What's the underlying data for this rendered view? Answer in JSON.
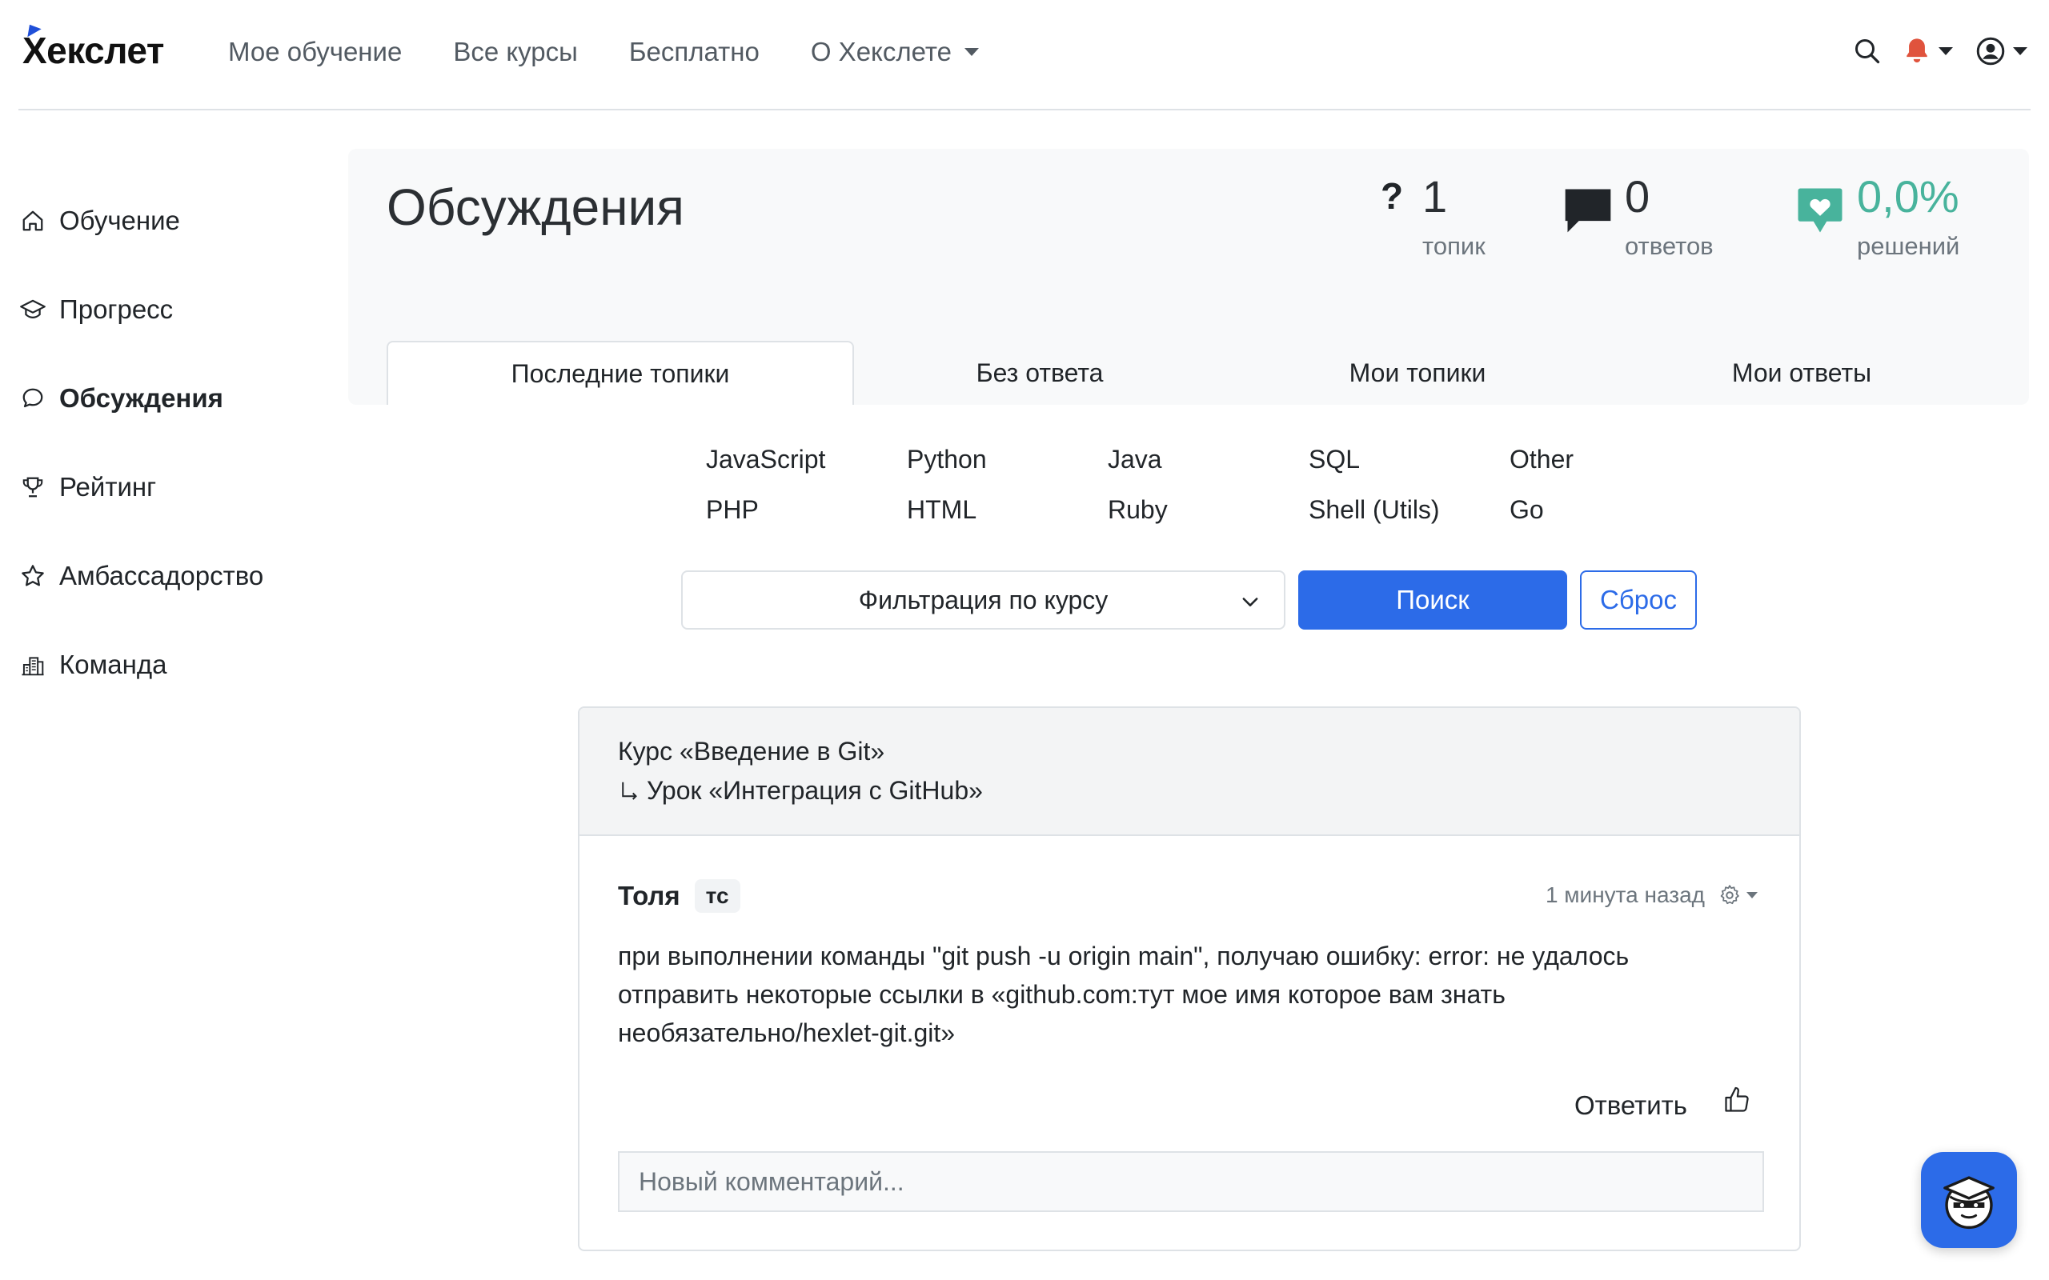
{
  "brand": {
    "logo_text": "Хекслет",
    "accent": "#2c6be8",
    "mark_color": "#1f4fd8"
  },
  "topnav": {
    "items": [
      {
        "label": "Мое обучение"
      },
      {
        "label": "Все курсы"
      },
      {
        "label": "Бесплатно"
      },
      {
        "label": "О Хекслете",
        "has_dropdown": true
      }
    ],
    "right_icons": [
      "search-icon",
      "bell-icon",
      "user-circle-icon"
    ],
    "bell_color": "#e0533d"
  },
  "sidebar": {
    "items": [
      {
        "label": "Обучение",
        "icon": "home-icon"
      },
      {
        "label": "Прогресс",
        "icon": "graduation-cap-icon"
      },
      {
        "label": "Обсуждения",
        "icon": "chat-bubble-icon",
        "active": true
      },
      {
        "label": "Рейтинг",
        "icon": "trophy-icon"
      },
      {
        "label": "Амбассадорство",
        "icon": "star-icon"
      },
      {
        "label": "Команда",
        "icon": "building-icon"
      }
    ]
  },
  "discussions": {
    "title": "Обсуждения",
    "stats": {
      "topics": {
        "symbol": "?",
        "value": "1",
        "label": "топик"
      },
      "answers": {
        "value": "0",
        "label": "ответов"
      },
      "solutions": {
        "value": "0,0%",
        "label": "решений",
        "color": "#48b39c"
      }
    },
    "tabs": [
      {
        "label": "Последние топики",
        "active": true
      },
      {
        "label": "Без ответа"
      },
      {
        "label": "Мои топики"
      },
      {
        "label": "Мои ответы"
      }
    ],
    "languages": [
      "JavaScript",
      "Python",
      "Java",
      "SQL",
      "Other",
      "PHP",
      "HTML",
      "Ruby",
      "Shell (Utils)",
      "Go"
    ],
    "filter": {
      "selected": "Фильтрация по курсу"
    },
    "search_label": "Поиск",
    "reset_label": "Сброс"
  },
  "topic": {
    "course": "Курс «Введение в Git»",
    "lesson": "Урок «Интеграция с GitHub»",
    "author": "Толя",
    "author_badge": "тс",
    "time": "1 минута назад",
    "message": "при выполнении команды \"git push -u origin main\", получаю ошибку: error: не удалось отправить некоторые ссылки в «github.com:тут мое имя которое вам знать необязательно/hexlet-git.git»",
    "reply_label": "Ответить",
    "comment_placeholder": "Новый комментарий..."
  }
}
